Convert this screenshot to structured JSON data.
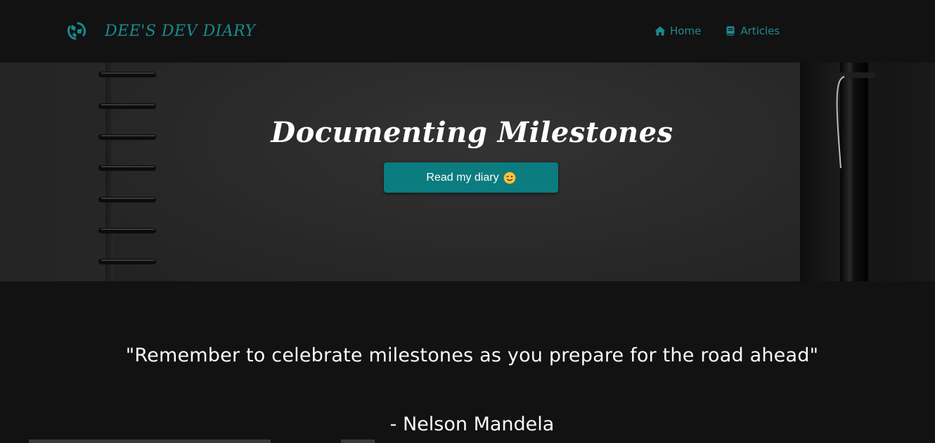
{
  "navbar": {
    "brand_title": "DEE'S DEV DIARY",
    "logo_icon": "brand-logo-icon",
    "links": [
      {
        "label": "Home",
        "icon": "home-icon"
      },
      {
        "label": "Articles",
        "icon": "book-icon"
      }
    ],
    "accent_color": "#1a8a8d"
  },
  "hero": {
    "title": "Documenting Milestones",
    "button_label": "Read my diary",
    "button_emoji": "winking-face-icon",
    "button_color": "#0b7c80"
  },
  "quote": {
    "text": "\"Remember to celebrate milestones as you prepare for the road ahead\"",
    "author": "- Nelson Mandela"
  }
}
